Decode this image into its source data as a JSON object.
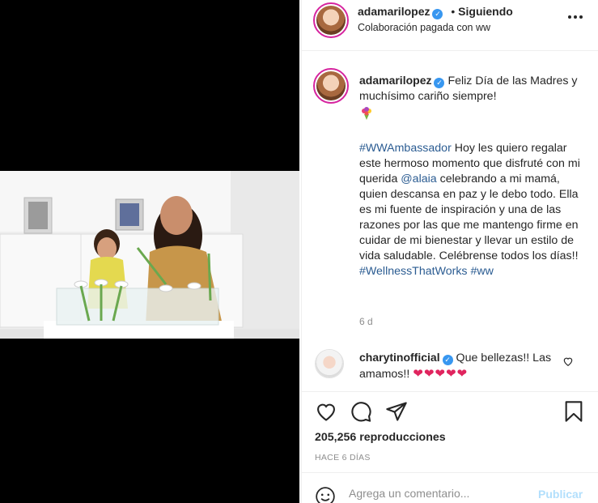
{
  "header": {
    "username": "adamarilopez",
    "separator": "•",
    "follow_status": "Siguiendo",
    "paid_partnership": "Colaboración pagada con ww",
    "more_icon": "more-options-icon"
  },
  "caption": {
    "username": "adamarilopez",
    "line1": "Feliz Día de las Madres y muchísimo cariño siempre!",
    "emoji": "bouquet-emoji",
    "hashtag_1": "#WWAmbassador",
    "body_1": " Hoy les quiero regalar este hermoso momento que disfruté con mi querida ",
    "mention": "@alaia",
    "body_2": " celebrando a mi mamá, quien descansa en paz y le debo todo. Ella es mi fuente de inspiración y una de las razones por las que me mantengo firme en cuidar de mi bienestar y llevar un estilo de vida saludable. Celébrense todos los días!! ",
    "hashtag_2": "#WellnessThatWorks",
    "hashtag_3": "#ww",
    "age": "6 d"
  },
  "comment": {
    "username": "charytinofficial",
    "text": "Que bellezas!! Las amamos!!",
    "hearts": "❤❤❤❤❤",
    "like_icon": "heart-outline-icon"
  },
  "actions": {
    "like_icon": "heart-outline-icon",
    "comment_icon": "comment-bubble-icon",
    "share_icon": "paper-plane-icon",
    "save_icon": "bookmark-icon",
    "views": "205,256 reproducciones",
    "posted": "HACE 6 DÍAS"
  },
  "comment_box": {
    "emoji_icon": "smiley-face-icon",
    "placeholder": "Agrega un comentario...",
    "publish_label": "Publicar"
  },
  "colors": {
    "verified": "#3897f0",
    "link": "#2b5c92",
    "hearts": "#e0245e",
    "publish_disabled": "#b2dffc"
  }
}
